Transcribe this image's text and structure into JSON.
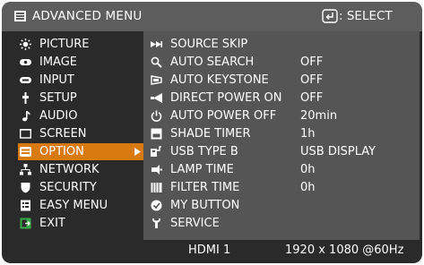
{
  "header": {
    "title": "ADVANCED MENU",
    "title_icon": "menu-icon",
    "select_label": "SELECT",
    "select_icon": "enter-key-icon"
  },
  "sidebar": {
    "items": [
      {
        "label": "PICTURE",
        "icon": "picture-icon"
      },
      {
        "label": "IMAGE",
        "icon": "image-icon"
      },
      {
        "label": "INPUT",
        "icon": "input-icon"
      },
      {
        "label": "SETUP",
        "icon": "setup-icon"
      },
      {
        "label": "AUDIO",
        "icon": "audio-icon"
      },
      {
        "label": "SCREEN",
        "icon": "screen-icon"
      },
      {
        "label": "OPTION",
        "icon": "option-icon",
        "selected": true
      },
      {
        "label": "NETWORK",
        "icon": "network-icon"
      },
      {
        "label": "SECURITY",
        "icon": "security-icon"
      },
      {
        "label": "EASY MENU",
        "icon": "easy-menu-icon"
      },
      {
        "label": "EXIT",
        "icon": "exit-icon"
      }
    ]
  },
  "options": {
    "rows": [
      {
        "label": "SOURCE SKIP",
        "value": "",
        "icon": "source-skip-icon"
      },
      {
        "label": "AUTO SEARCH",
        "value": "OFF",
        "icon": "auto-search-icon"
      },
      {
        "label": "AUTO KEYSTONE",
        "value": "OFF",
        "icon": "auto-keystone-icon"
      },
      {
        "label": "DIRECT POWER ON",
        "value": "OFF",
        "icon": "direct-power-on-icon"
      },
      {
        "label": "AUTO POWER OFF",
        "value": "20min",
        "icon": "auto-power-off-icon"
      },
      {
        "label": "SHADE TIMER",
        "value": "1h",
        "icon": "shade-timer-icon"
      },
      {
        "label": "USB TYPE B",
        "value": "USB DISPLAY",
        "icon": "usb-type-b-icon"
      },
      {
        "label": "LAMP TIME",
        "value": "0h",
        "icon": "lamp-time-icon"
      },
      {
        "label": "FILTER TIME",
        "value": "0h",
        "icon": "filter-time-icon"
      },
      {
        "label": "MY BUTTON",
        "value": "",
        "icon": "my-button-icon"
      },
      {
        "label": "SERVICE",
        "value": "",
        "icon": "service-icon"
      }
    ]
  },
  "status": {
    "input": "HDMI 1",
    "resolution": "1920 x 1080 @60Hz"
  },
  "colors": {
    "background": "#2a2a2a",
    "title_bar": "#5d5d5d",
    "panel": "#555555",
    "highlight": "#d87a10",
    "text": "#ffffff"
  }
}
